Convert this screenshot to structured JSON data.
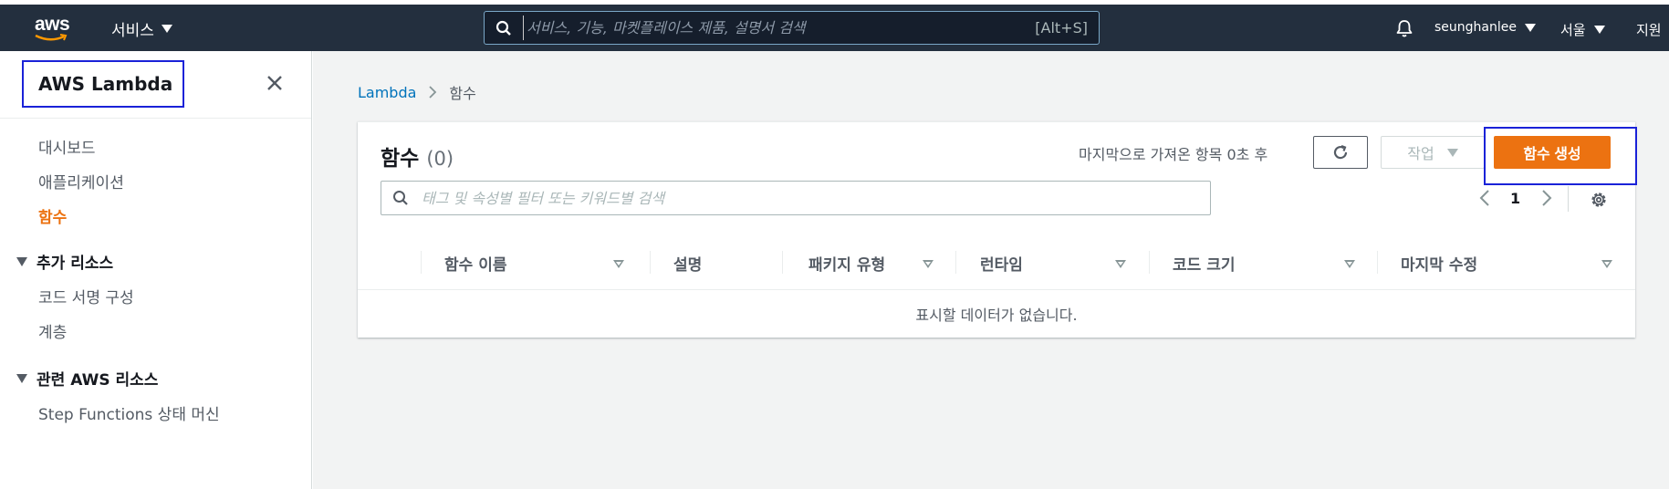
{
  "topnav": {
    "logo": "aws",
    "services_label": "서비스",
    "search_placeholder": "서비스, 기능, 마켓플레이스 제품, 설명서 검색",
    "search_shortcut": "[Alt+S]",
    "user": "seunghanlee",
    "region": "서울",
    "support": "지원"
  },
  "sidebar": {
    "title": "AWS Lambda",
    "items": [
      {
        "label": "대시보드"
      },
      {
        "label": "애플리케이션"
      },
      {
        "label": "함수",
        "active": true
      }
    ],
    "sections": [
      {
        "label": "추가 리소스",
        "items": [
          {
            "label": "코드 서명 구성"
          },
          {
            "label": "계층"
          }
        ]
      },
      {
        "label": "관련 AWS 리소스",
        "items": [
          {
            "label": "Step Functions 상태 머신"
          }
        ]
      }
    ]
  },
  "breadcrumb": {
    "root": "Lambda",
    "current": "함수"
  },
  "functions_panel": {
    "title": "함수",
    "count": "(0)",
    "last_fetched": "마지막으로 가져온 항목 0초 후",
    "actions_label": "작업",
    "create_label": "함수 생성",
    "filter_placeholder": "태그 및 속성별 필터 또는 키워드별 검색",
    "page": "1",
    "columns": [
      "함수 이름",
      "설명",
      "패키지 유형",
      "런타임",
      "코드 크기",
      "마지막 수정"
    ],
    "empty_message": "표시할 데이터가 없습니다."
  },
  "colors": {
    "nav_bg": "#232f3e",
    "accent": "#ec7211",
    "link": "#0073bb",
    "highlight_box": "#1a22d8"
  }
}
